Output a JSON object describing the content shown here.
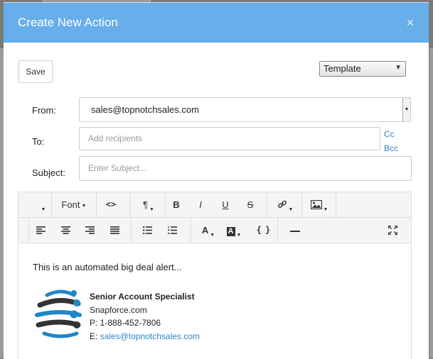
{
  "modal": {
    "title": "Create New Action",
    "close_glyph": "×"
  },
  "toolbar": {
    "save_label": "Save",
    "template_label": "Template",
    "template_arrow": "▼"
  },
  "form": {
    "from_label": "From:",
    "from_value": "sales@topnotchsales.com",
    "to_label": "To:",
    "to_placeholder": "Add recipients",
    "cc_label": "Cc",
    "bcc_label": "Bcc",
    "subject_label": "Subject:",
    "subject_placeholder": "Enter Subject..."
  },
  "editor_toolbar": {
    "font_label": "Font",
    "code_label": "<>",
    "paragraph_label": "¶",
    "bold_label": "B",
    "italic_label": "I",
    "underline_label": "U",
    "strike_label": "S",
    "font_color_label": "A",
    "highlight_label": "A",
    "source_label": "{ }"
  },
  "editor_body": {
    "intro": "This is an automated big deal alert...",
    "signature": {
      "title": "Senior Account Specialist",
      "company": "Snapforce.com",
      "phone": "P: 1-888-452-7806",
      "email_prefix": "E: ",
      "email": "sales@topnotchsales.com"
    }
  },
  "colors": {
    "header": "#67aeea",
    "link": "#2f86c8",
    "logo_blue": "#1f86c8",
    "logo_dark": "#333333"
  }
}
